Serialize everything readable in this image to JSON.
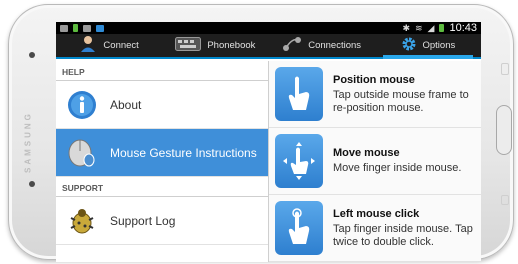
{
  "device": {
    "brand": "SAMSUNG"
  },
  "status_bar": {
    "time": "10:43",
    "icons": [
      "email-icon",
      "battery-saver-icon",
      "usb-icon",
      "app-icon",
      "bluetooth-icon",
      "wifi-icon",
      "signal-icon",
      "battery-icon"
    ]
  },
  "tabs": [
    {
      "label": "Connect",
      "icon": "person-icon",
      "active": false
    },
    {
      "label": "Phonebook",
      "icon": "keyboard-icon",
      "active": false
    },
    {
      "label": "Connections",
      "icon": "link-icon",
      "active": false
    },
    {
      "label": "Options",
      "icon": "gear-icon",
      "active": true
    }
  ],
  "sidebar": {
    "sections": [
      {
        "header": "HELP",
        "items": [
          {
            "label": "About",
            "icon": "info-icon",
            "selected": false
          },
          {
            "label": "Mouse Gesture Instructions",
            "icon": "mouse-icon",
            "selected": true
          }
        ]
      },
      {
        "header": "SUPPORT",
        "items": [
          {
            "label": "Support Log",
            "icon": "bug-icon",
            "selected": false
          }
        ]
      }
    ]
  },
  "instructions": [
    {
      "title": "Position mouse",
      "description": "Tap outside mouse frame to re-position mouse.",
      "icon": "position-hand-icon"
    },
    {
      "title": "Move mouse",
      "description": "Move finger inside mouse.",
      "icon": "move-hand-icon"
    },
    {
      "title": "Left mouse click",
      "description": "Tap finger inside mouse. Tap twice to double click.",
      "icon": "tap-hand-icon"
    }
  ],
  "colors": {
    "accent": "#29a7ea",
    "selected_row": "#3f8fd9",
    "tab_bar": "#1e1e1e",
    "status_bar": "#000000"
  }
}
